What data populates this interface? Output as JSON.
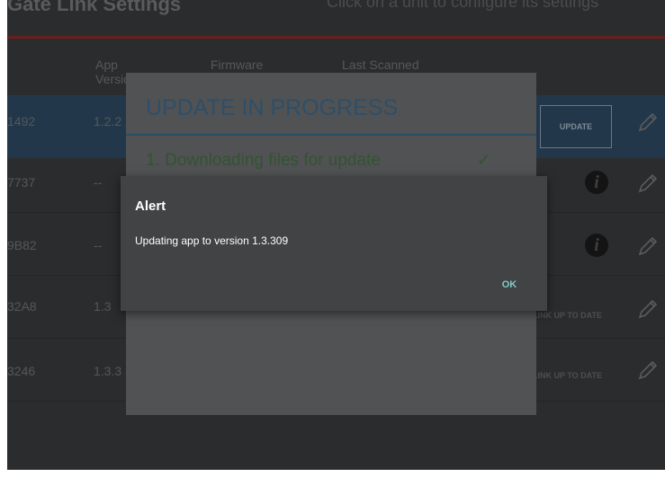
{
  "app": {
    "title": "Gate Link Settings",
    "subtitle": "Click on a unit to configure its settings"
  },
  "table": {
    "headers": {
      "app_version": "App Version",
      "firmware": "Firmware",
      "last_scanned": "Last Scanned"
    },
    "rows": [
      {
        "id": "1492",
        "version": "1.2.2",
        "action": "UPDATE"
      },
      {
        "id": "7737",
        "version": "--",
        "action": ""
      },
      {
        "id": "9B82",
        "version": "--",
        "action": ""
      },
      {
        "id": "32A8",
        "version": "1.3",
        "action": "LINK UP TO DATE"
      },
      {
        "id": "3246",
        "version": "1.3.3",
        "action": "LINK UP TO DATE"
      }
    ]
  },
  "progress_dialog": {
    "title": "UPDATE IN PROGRESS",
    "step1": "1. Downloading files for update",
    "step1_mark": "✓"
  },
  "alert": {
    "title": "Alert",
    "message": "Updating app to version 1.3.309",
    "ok_label": "OK"
  },
  "icons": {
    "info": "info-icon",
    "edit": "pencil-icon"
  },
  "colors": {
    "accent": "#80cbc4",
    "dialog_title": "#2d4f6a",
    "step_done": "#335233"
  }
}
